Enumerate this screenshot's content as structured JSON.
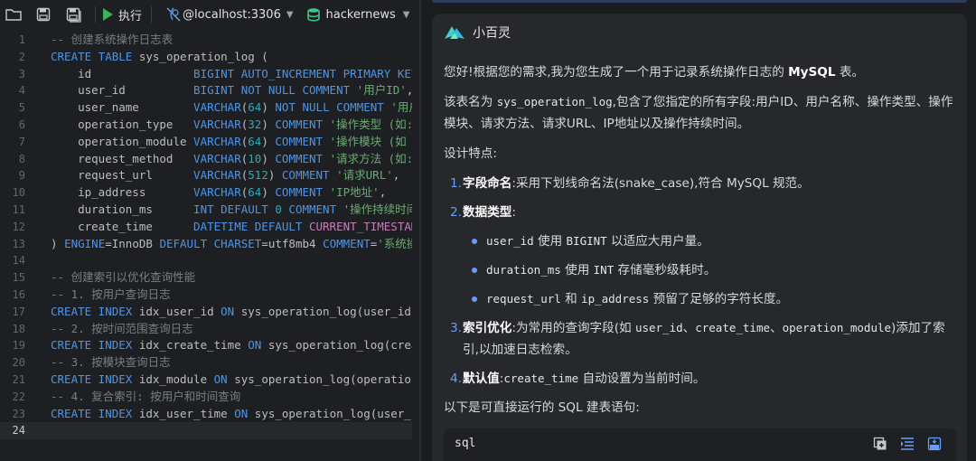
{
  "toolbar": {
    "run_label": "执行",
    "datasource": "@localhost:3306",
    "database": "hackernews"
  },
  "editor": {
    "current_line": 24,
    "lines": [
      {
        "n": "1",
        "tokens": [
          {
            "t": "-- 创建系统操作日志表",
            "c": "cm"
          }
        ]
      },
      {
        "n": "2",
        "tokens": [
          {
            "t": "CREATE TABLE",
            "c": "kw"
          },
          {
            "t": " sys_operation_log (",
            "c": ""
          }
        ]
      },
      {
        "n": "3",
        "tokens": [
          {
            "t": "    id               ",
            "c": ""
          },
          {
            "t": "BIGINT AUTO_INCREMENT PRIMARY KEY",
            "c": "kw"
          }
        ]
      },
      {
        "n": "4",
        "tokens": [
          {
            "t": "    user_id          ",
            "c": ""
          },
          {
            "t": "BIGINT NOT NULL COMMENT ",
            "c": "kw"
          },
          {
            "t": "'用户ID'",
            "c": "st"
          },
          {
            "t": ",",
            "c": ""
          }
        ]
      },
      {
        "n": "5",
        "tokens": [
          {
            "t": "    user_name        ",
            "c": ""
          },
          {
            "t": "VARCHAR",
            "c": "kw"
          },
          {
            "t": "(",
            "c": ""
          },
          {
            "t": "64",
            "c": "nm"
          },
          {
            "t": ") ",
            "c": ""
          },
          {
            "t": "NOT NULL COMMENT ",
            "c": "kw"
          },
          {
            "t": "'用户",
            "c": "st"
          }
        ]
      },
      {
        "n": "6",
        "tokens": [
          {
            "t": "    operation_type   ",
            "c": ""
          },
          {
            "t": "VARCHAR",
            "c": "kw"
          },
          {
            "t": "(",
            "c": ""
          },
          {
            "t": "32",
            "c": "nm"
          },
          {
            "t": ") ",
            "c": ""
          },
          {
            "t": "COMMENT ",
            "c": "kw"
          },
          {
            "t": "'操作类型 (如:",
            "c": "st"
          }
        ]
      },
      {
        "n": "7",
        "tokens": [
          {
            "t": "    operation_module ",
            "c": ""
          },
          {
            "t": "VARCHAR",
            "c": "kw"
          },
          {
            "t": "(",
            "c": ""
          },
          {
            "t": "64",
            "c": "nm"
          },
          {
            "t": ") ",
            "c": ""
          },
          {
            "t": "COMMENT ",
            "c": "kw"
          },
          {
            "t": "'操作模块 (如",
            "c": "st"
          }
        ]
      },
      {
        "n": "8",
        "tokens": [
          {
            "t": "    request_method   ",
            "c": ""
          },
          {
            "t": "VARCHAR",
            "c": "kw"
          },
          {
            "t": "(",
            "c": ""
          },
          {
            "t": "10",
            "c": "nm"
          },
          {
            "t": ") ",
            "c": ""
          },
          {
            "t": "COMMENT ",
            "c": "kw"
          },
          {
            "t": "'请求方法 (如:",
            "c": "st"
          }
        ]
      },
      {
        "n": "9",
        "tokens": [
          {
            "t": "    request_url      ",
            "c": ""
          },
          {
            "t": "VARCHAR",
            "c": "kw"
          },
          {
            "t": "(",
            "c": ""
          },
          {
            "t": "512",
            "c": "nm"
          },
          {
            "t": ") ",
            "c": ""
          },
          {
            "t": "COMMENT ",
            "c": "kw"
          },
          {
            "t": "'请求URL'",
            "c": "st"
          },
          {
            "t": ",",
            "c": ""
          }
        ]
      },
      {
        "n": "10",
        "tokens": [
          {
            "t": "    ip_address       ",
            "c": ""
          },
          {
            "t": "VARCHAR",
            "c": "kw"
          },
          {
            "t": "(",
            "c": ""
          },
          {
            "t": "64",
            "c": "nm"
          },
          {
            "t": ") ",
            "c": ""
          },
          {
            "t": "COMMENT ",
            "c": "kw"
          },
          {
            "t": "'IP地址'",
            "c": "st"
          },
          {
            "t": ",",
            "c": ""
          }
        ]
      },
      {
        "n": "11",
        "tokens": [
          {
            "t": "    duration_ms      ",
            "c": ""
          },
          {
            "t": "INT DEFAULT ",
            "c": "kw"
          },
          {
            "t": "0",
            "c": "nm"
          },
          {
            "t": " COMMENT ",
            "c": "kw"
          },
          {
            "t": "'操作持续时间",
            "c": "st"
          }
        ]
      },
      {
        "n": "12",
        "tokens": [
          {
            "t": "    create_time      ",
            "c": ""
          },
          {
            "t": "DATETIME DEFAULT ",
            "c": "kw"
          },
          {
            "t": "CURRENT_TIMESTAMP",
            "c": "fn"
          }
        ]
      },
      {
        "n": "13",
        "tokens": [
          {
            "t": ") ",
            "c": ""
          },
          {
            "t": "ENGINE",
            "c": "kw"
          },
          {
            "t": "=InnoDB ",
            "c": ""
          },
          {
            "t": "DEFAULT CHARSET",
            "c": "kw"
          },
          {
            "t": "=utf8mb4 ",
            "c": ""
          },
          {
            "t": "COMMENT",
            "c": "kw"
          },
          {
            "t": "=",
            "c": ""
          },
          {
            "t": "'系统操",
            "c": "st"
          }
        ]
      },
      {
        "n": "14",
        "tokens": []
      },
      {
        "n": "15",
        "tokens": [
          {
            "t": "-- 创建索引以优化查询性能",
            "c": "cm"
          }
        ]
      },
      {
        "n": "16",
        "tokens": [
          {
            "t": "-- 1. 按用户查询日志",
            "c": "cm"
          }
        ]
      },
      {
        "n": "17",
        "tokens": [
          {
            "t": "CREATE INDEX",
            "c": "kw"
          },
          {
            "t": " idx_user_id ",
            "c": ""
          },
          {
            "t": "ON",
            "c": "kw"
          },
          {
            "t": " sys_operation_log(user_id);",
            "c": ""
          }
        ]
      },
      {
        "n": "18",
        "tokens": [
          {
            "t": "-- 2. 按时间范围查询日志",
            "c": "cm"
          }
        ]
      },
      {
        "n": "19",
        "tokens": [
          {
            "t": "CREATE INDEX",
            "c": "kw"
          },
          {
            "t": " idx_create_time ",
            "c": ""
          },
          {
            "t": "ON",
            "c": "kw"
          },
          {
            "t": " sys_operation_log(create_time);",
            "c": ""
          }
        ]
      },
      {
        "n": "20",
        "tokens": [
          {
            "t": "-- 3. 按模块查询日志",
            "c": "cm"
          }
        ]
      },
      {
        "n": "21",
        "tokens": [
          {
            "t": "CREATE INDEX",
            "c": "kw"
          },
          {
            "t": " idx_module ",
            "c": ""
          },
          {
            "t": "ON",
            "c": "kw"
          },
          {
            "t": " sys_operation_log(operation_module);",
            "c": ""
          }
        ]
      },
      {
        "n": "22",
        "tokens": [
          {
            "t": "-- 4. 复合索引: 按用户和时间查询",
            "c": "cm"
          }
        ]
      },
      {
        "n": "23",
        "tokens": [
          {
            "t": "CREATE INDEX",
            "c": "kw"
          },
          {
            "t": " idx_user_time ",
            "c": ""
          },
          {
            "t": "ON",
            "c": "kw"
          },
          {
            "t": " sys_operation_log(user_i",
            "c": ""
          }
        ]
      },
      {
        "n": "24",
        "tokens": []
      }
    ]
  },
  "assistant": {
    "name": "小百灵",
    "intro": [
      {
        "t": "您好!根据您的需求,我为您生成了一个用于记录系统操作日志的 ",
        "s": ""
      },
      {
        "t": "MySQL",
        "s": "b"
      },
      {
        "t": " 表。",
        "s": ""
      }
    ],
    "desc": [
      {
        "t": "该表名为 ",
        "s": ""
      },
      {
        "t": "sys_operation_log",
        "s": "mono"
      },
      {
        "t": ",包含了您指定的所有字段:用户ID、用户名称、操作类型、操作模块、请求方法、请求URL、IP地址以及操作持续时间。",
        "s": ""
      }
    ],
    "design_title": "设计特点:",
    "points": [
      {
        "num": "1.",
        "parts": [
          {
            "t": "字段命名",
            "s": "b"
          },
          {
            "t": ":采用下划线命名法(snake_case),符合 MySQL 规范。",
            "s": ""
          }
        ]
      },
      {
        "num": "2.",
        "parts": [
          {
            "t": "数据类型",
            "s": "b"
          },
          {
            "t": ":",
            "s": ""
          }
        ],
        "subs": [
          [
            {
              "t": "user_id",
              "s": "mono"
            },
            {
              "t": " 使用 ",
              "s": ""
            },
            {
              "t": "BIGINT",
              "s": "mono"
            },
            {
              "t": " 以适应大用户量。",
              "s": ""
            }
          ],
          [
            {
              "t": "duration_ms",
              "s": "mono"
            },
            {
              "t": " 使用 ",
              "s": ""
            },
            {
              "t": "INT",
              "s": "mono"
            },
            {
              "t": " 存储毫秒级耗时。",
              "s": ""
            }
          ],
          [
            {
              "t": "request_url",
              "s": "mono"
            },
            {
              "t": " 和 ",
              "s": ""
            },
            {
              "t": "ip_address",
              "s": "mono"
            },
            {
              "t": " 预留了足够的字符长度。",
              "s": ""
            }
          ]
        ]
      },
      {
        "num": "3.",
        "parts": [
          {
            "t": "索引优化",
            "s": "b"
          },
          {
            "t": ":为常用的查询字段(如 ",
            "s": ""
          },
          {
            "t": "user_id",
            "s": "mono"
          },
          {
            "t": "、",
            "s": ""
          },
          {
            "t": "create_time",
            "s": "mono"
          },
          {
            "t": "、",
            "s": ""
          },
          {
            "t": "operation_module",
            "s": "mono"
          },
          {
            "t": ")添加了索引,以加速日志检索。",
            "s": ""
          }
        ]
      },
      {
        "num": "4.",
        "parts": [
          {
            "t": "默认值",
            "s": "b"
          },
          {
            "t": ":",
            "s": ""
          },
          {
            "t": "create_time",
            "s": "mono"
          },
          {
            "t": " 自动设置为当前时间。",
            "s": ""
          }
        ]
      }
    ],
    "outro": "以下是可直接运行的 SQL 建表语句:",
    "code_lang": "sql"
  },
  "colors": {
    "keyword": "#4d95e7",
    "comment": "#7a7e85",
    "string": "#6aab73",
    "number": "#2aacb8",
    "accent": "#6a9ef5",
    "run": "#43b05c"
  },
  "icons": [
    "folder-icon",
    "save-icon",
    "save-all-icon",
    "run-icon",
    "datasource-icon",
    "database-icon",
    "assistant-logo-icon",
    "insert-code-icon",
    "format-code-icon",
    "sql-file-icon"
  ]
}
